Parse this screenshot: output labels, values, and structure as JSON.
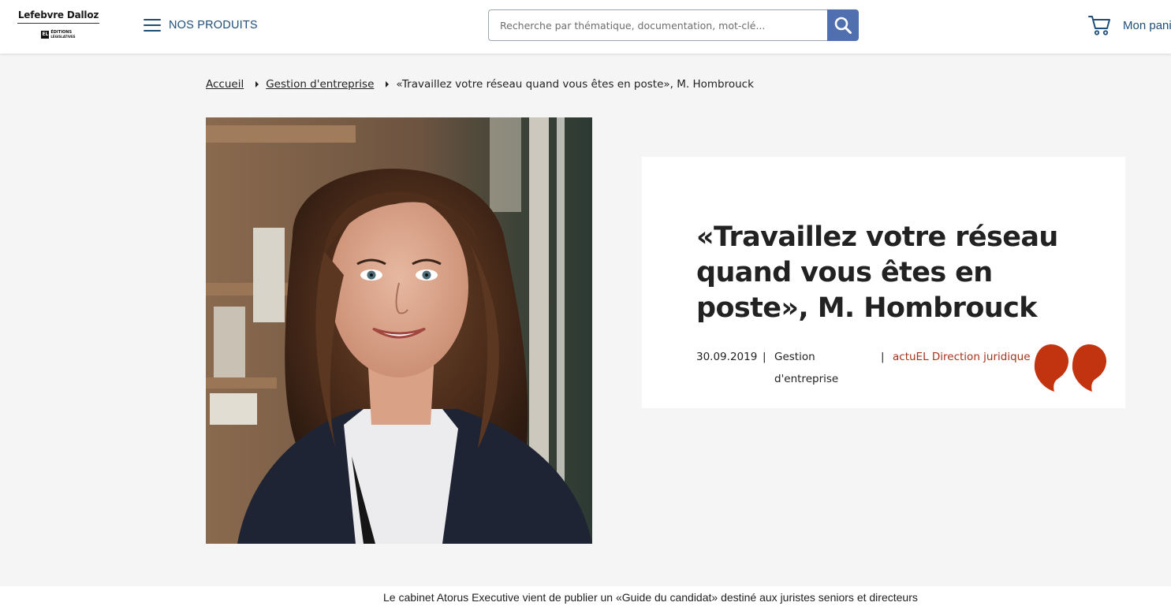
{
  "header": {
    "brand_name": "Lefebvre Dalloz",
    "brand_badge": "EL",
    "brand_sub_line1": "ÉDITIONS",
    "brand_sub_line2": "LÉGISLATIVES",
    "menu_label": "NOS PRODUITS",
    "search_placeholder": "Recherche par thématique, documentation, mot-clé...",
    "cart_label": "Mon panier",
    "accent_color": "#1f4e79",
    "search_button_color": "#4f6fae"
  },
  "breadcrumb": {
    "items": [
      {
        "label": "Accueil"
      },
      {
        "label": "Gestion d'entreprise"
      },
      {
        "label": "«Travaillez votre réseau quand vous êtes en poste», M. Hombrouck"
      }
    ]
  },
  "article": {
    "title": "«Travaillez votre réseau quand vous êtes en poste», M. Hombrouck",
    "date": "30.09.2019",
    "separator": "|",
    "category": "Gestion d'entreprise",
    "source": "actuEL Direction juridique",
    "source_color": "#a3331b",
    "quote_icon": "quote-icon",
    "photo_icon": "portrait-photo",
    "lead": "Le cabinet Atorus Executive vient de publier un «Guide du candidat» destiné aux juristes seniors et directeurs"
  }
}
